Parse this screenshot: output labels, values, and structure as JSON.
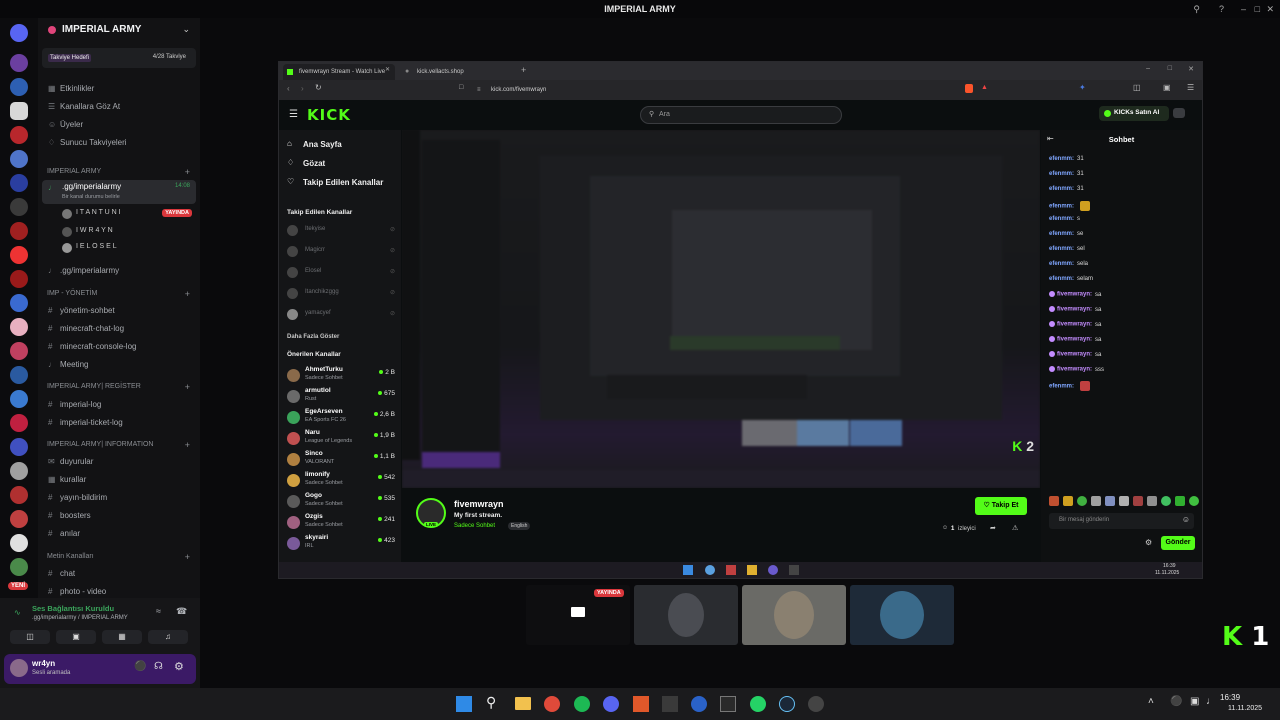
{
  "app_title": "IMPERIAL ARMY",
  "discord": {
    "server_name": "IMPERIAL ARMY",
    "boost_label": "Takviye Hedefi",
    "boost_count": "4/28 Takviye",
    "top_items": [
      "Etkinlikler",
      "Kanallara Göz At",
      "Üyeler",
      "Sunucu Takviyeleri"
    ],
    "cat1": "IMPERIAL ARMY",
    "voice_channel": ".gg/imperialarmy",
    "voice_time": "14:08",
    "voice_status": "Bir kanal durumu belirle",
    "voice_users": [
      {
        "name": "I T A N T U N I",
        "live": "YAYINDA"
      },
      {
        "name": "I W R 4 Y N",
        "live": ""
      },
      {
        "name": "I E L O S E L",
        "live": ""
      }
    ],
    "channel2": ".gg/imperialarmy",
    "cat2": "IMP - YÖNETİM",
    "cat2_items": [
      "yönetim-sohbet",
      "minecraft-chat-log",
      "minecraft-console-log",
      "Meeting"
    ],
    "cat3": "IMPERIAL ARMY| REGİSTER",
    "cat3_items": [
      "imperial-log",
      "imperial-ticket-log"
    ],
    "cat4": "IMPERIAL ARMY| INFORMATION",
    "cat4_items": [
      "duyurular",
      "kurallar",
      "yayın-bildirim",
      "boosters",
      "anılar"
    ],
    "cat5": "Metin Kanalları",
    "cat5_items": [
      "chat",
      "photo - video"
    ],
    "new_badge": "YENİ",
    "voice_connected": "Ses Bağlantısı Kuruldu",
    "voice_connected_sub": ".gg/imperialarmy / IMPERIAL ARMY",
    "username": "wr4yn",
    "user_status": "Sesli aramada"
  },
  "browser": {
    "tab1": "fivemwrayn Stream - Watch Live",
    "tab2": "kick.vellacts.shop",
    "url": "kick.com/fivemwrayn",
    "search_placeholder": "Ara",
    "buy_kicks": "KICKs Satın Al"
  },
  "kick": {
    "logo": "KICK",
    "nav": [
      "Ana Sayfa",
      "Gözat",
      "Takip Edilen Kanallar"
    ],
    "followed_header": "Takip Edilen Kanallar",
    "followed": [
      "Itekyise",
      "Magicrr",
      "Elosel",
      "Itanchikzggg",
      "yamacyef"
    ],
    "show_more": "Daha Fazla Göster",
    "recommended_header": "Önerilen Kanallar",
    "recommended": [
      {
        "name": "AhmetTurku",
        "cat": "Sadece Sohbet",
        "viewers": "2 B",
        "color": "#8a6a4a"
      },
      {
        "name": "armutlol",
        "cat": "Rust",
        "viewers": "675",
        "color": "#6a6a6a"
      },
      {
        "name": "EgeArseven",
        "cat": "EA Sports FC 26",
        "viewers": "2,6 B",
        "color": "#3aa35a"
      },
      {
        "name": "Naru",
        "cat": "League of Legends",
        "viewers": "1,9 B",
        "color": "#c05050"
      },
      {
        "name": "Sinco",
        "cat": "VALORANT",
        "viewers": "1,1 B",
        "color": "#b08040"
      },
      {
        "name": "limonify",
        "cat": "Sadece Sohbet",
        "viewers": "542",
        "color": "#d0a040"
      },
      {
        "name": "Gogo",
        "cat": "Sadece Sohbet",
        "viewers": "535",
        "color": "#5a5a5a"
      },
      {
        "name": "Ozgis",
        "cat": "Sadece Sohbet",
        "viewers": "241",
        "color": "#a06080"
      },
      {
        "name": "skyrairi",
        "cat": "IRL",
        "viewers": "423",
        "color": "#7a5a9a"
      }
    ],
    "streamer": "fivemwrayn",
    "stream_title": "My first stream.",
    "category": "Sadece Sohbet",
    "language": "English",
    "follow": "Takip Et",
    "viewers": "1",
    "viewers_label": "izleyici",
    "live_badge": "LIVE",
    "chat_title": "Sohbet",
    "chat": [
      {
        "user": "efenmm:",
        "msg": "31",
        "style": "u"
      },
      {
        "user": "efenmm:",
        "msg": "31",
        "style": "u"
      },
      {
        "user": "efenmm:",
        "msg": "31",
        "style": "u"
      },
      {
        "user": "efenmm:",
        "msg": "",
        "style": "u"
      },
      {
        "user": "efenmm:",
        "msg": "s",
        "style": "u"
      },
      {
        "user": "efenmm:",
        "msg": "se",
        "style": "u"
      },
      {
        "user": "efenmm:",
        "msg": "sel",
        "style": "u"
      },
      {
        "user": "efenmm:",
        "msg": "sela",
        "style": "u"
      },
      {
        "user": "efenmm:",
        "msg": "selam",
        "style": "u"
      },
      {
        "user": "fivemwrayn:",
        "msg": "sa",
        "style": "u2"
      },
      {
        "user": "fivemwrayn:",
        "msg": "sa",
        "style": "u2"
      },
      {
        "user": "fivemwrayn:",
        "msg": "sa",
        "style": "u2"
      },
      {
        "user": "fivemwrayn:",
        "msg": "sa",
        "style": "u2"
      },
      {
        "user": "fivemwrayn:",
        "msg": "sa",
        "style": "u2"
      },
      {
        "user": "fivemwrayn:",
        "msg": "sss",
        "style": "u2"
      },
      {
        "user": "efenmm:",
        "msg": "",
        "style": "u"
      }
    ],
    "chat_placeholder": "Bir mesaj gönderin",
    "send": "Gönder"
  },
  "inner_taskbar": {
    "time": "16:39",
    "date": "11.11.2025"
  },
  "taskbar": {
    "time": "16:39",
    "date": "11.11.2025"
  },
  "overlay_badge": "YAYINDA",
  "k_viewer": "1",
  "k_viewer_inner": "2"
}
